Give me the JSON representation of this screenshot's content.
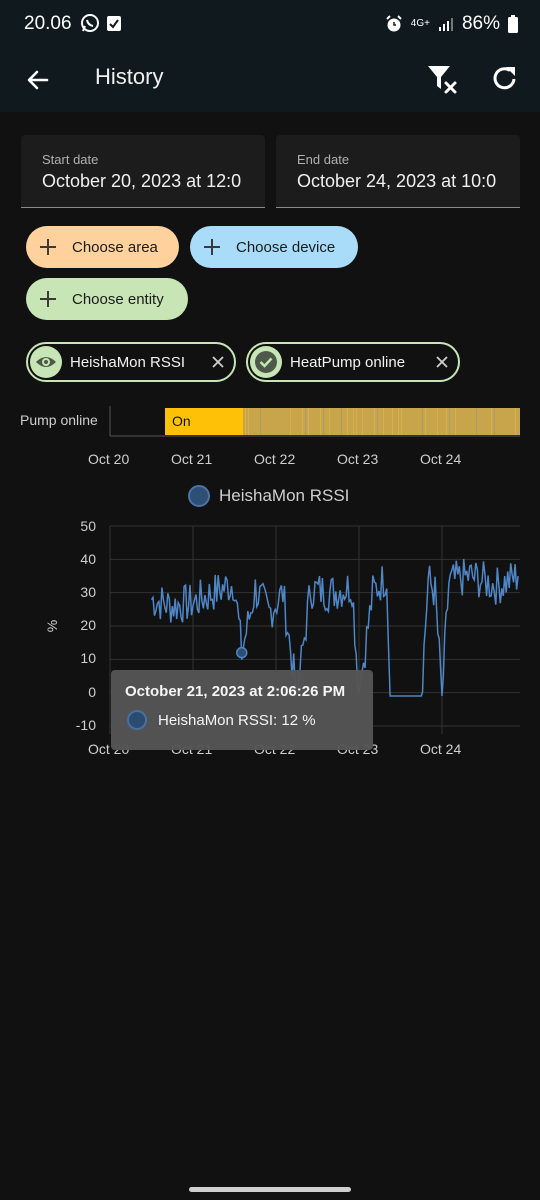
{
  "status_bar": {
    "time": "20.06",
    "network": "4G+",
    "battery": "86%"
  },
  "app_bar": {
    "title": "History"
  },
  "date_range": {
    "start_label": "Start date",
    "start_value": "October 20, 2023 at 12:0",
    "end_label": "End date",
    "end_value": "October 24, 2023 at 10:0"
  },
  "pickers": {
    "area": "Choose area",
    "device": "Choose device",
    "entity": "Choose entity"
  },
  "targets": [
    {
      "label": "HeishaMon RSSI",
      "icon": "eye-icon"
    },
    {
      "label": "HeatPump online",
      "icon": "check-circle-icon"
    }
  ],
  "timeline": {
    "entity_label": "Pump online",
    "state_label": "On",
    "colors": {
      "on": "#ffc107",
      "other": "#c8a54a"
    },
    "x_ticks": [
      "Oct 20",
      "Oct 21",
      "Oct 22",
      "Oct 23",
      "Oct 24"
    ]
  },
  "chart_data": {
    "type": "line",
    "y_unit": "%",
    "ylim": [
      -10,
      50
    ],
    "y_ticks": [
      "50",
      "40",
      "30",
      "20",
      "10",
      "0",
      "-10"
    ],
    "x_ticks": [
      "Oct 20",
      "Oct 21",
      "Oct 22",
      "Oct 23",
      "Oct 24"
    ],
    "grid": true,
    "legend_position": "top-center",
    "series": [
      {
        "name": "HeishaMon RSSI",
        "color": "#4f86c6",
        "points": [
          [
            "2023-10-20 12:00",
            28
          ],
          [
            "2023-10-20 18:00",
            26
          ],
          [
            "2023-10-21 00:00",
            27
          ],
          [
            "2023-10-21 06:00",
            30
          ],
          [
            "2023-10-21 12:00",
            33
          ],
          [
            "2023-10-21 14:06",
            12
          ],
          [
            "2023-10-21 18:00",
            31
          ],
          [
            "2023-10-21 22:00",
            24
          ],
          [
            "2023-10-22 02:00",
            30
          ],
          [
            "2023-10-22 06:00",
            -1
          ],
          [
            "2023-10-22 10:00",
            31
          ],
          [
            "2023-10-22 16:00",
            30
          ],
          [
            "2023-10-22 22:00",
            32
          ],
          [
            "2023-10-23 00:00",
            0
          ],
          [
            "2023-10-23 04:00",
            30
          ],
          [
            "2023-10-23 08:00",
            35
          ],
          [
            "2023-10-23 09:00",
            -1
          ],
          [
            "2023-10-23 18:00",
            -1
          ],
          [
            "2023-10-23 20:00",
            34
          ],
          [
            "2023-10-23 22:00",
            30
          ],
          [
            "2023-10-24 00:00",
            -1
          ],
          [
            "2023-10-24 02:00",
            33
          ],
          [
            "2023-10-24 08:00",
            35
          ],
          [
            "2023-10-24 16:00",
            32
          ],
          [
            "2023-10-24 22:00",
            35
          ]
        ]
      }
    ]
  },
  "tooltip": {
    "title": "October 21, 2023 at 2:06:26 PM",
    "series": "HeishaMon RSSI",
    "value_text": "HeishaMon RSSI: 12 %"
  }
}
